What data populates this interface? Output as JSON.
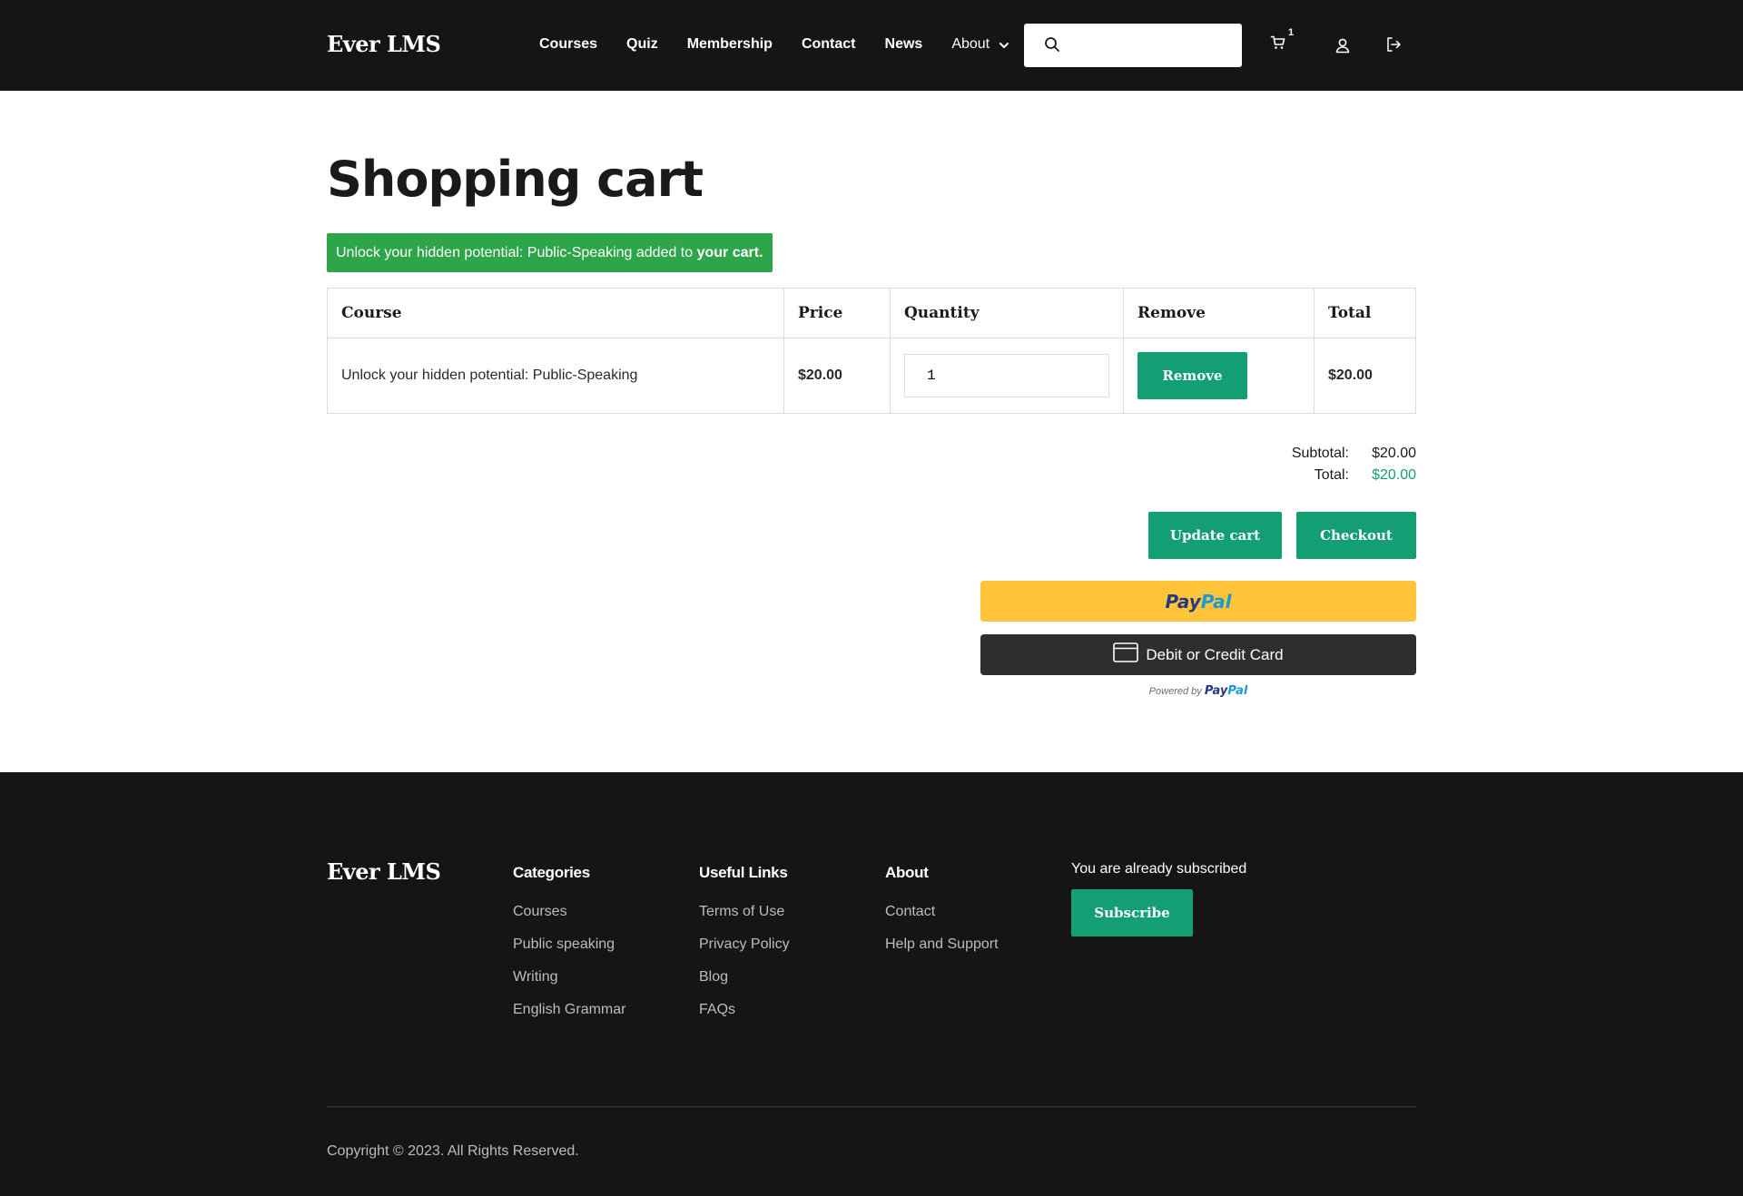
{
  "header": {
    "logo": "Ever LMS",
    "nav": {
      "courses": "Courses",
      "quiz": "Quiz",
      "membership": "Membership",
      "contact": "Contact",
      "news": "News",
      "about": "About"
    },
    "search": {
      "value": "",
      "placeholder": ""
    },
    "cart_count": "1"
  },
  "main": {
    "title": "Shopping cart",
    "alert": {
      "text": "Unlock your hidden potential: Public-Speaking added to ",
      "link": "your cart."
    },
    "table": {
      "headers": [
        "Course",
        "Price",
        "Quantity",
        "Remove",
        "Total"
      ],
      "rows": [
        {
          "course": "Unlock your hidden potential: Public-Speaking",
          "price": "$20.00",
          "quantity": "1",
          "remove_label": "Remove",
          "total": "$20.00"
        }
      ]
    },
    "totals": {
      "subtotal_label": "Subtotal:",
      "subtotal": "$20.00",
      "total_label": "Total:",
      "total": "$20.00"
    },
    "buttons": {
      "update": "Update cart",
      "checkout": "Checkout"
    },
    "paypal": {
      "pay": "Pay",
      "pal": "Pal",
      "card_label": "Debit or Credit Card",
      "powered_by": "Powered by"
    }
  },
  "footer": {
    "logo": "Ever LMS",
    "categories": {
      "title": "Categories",
      "links": [
        "Courses",
        "Public speaking",
        "Writing",
        "English Grammar"
      ]
    },
    "useful_links": {
      "title": "Useful Links",
      "links": [
        "Terms of Use",
        "Privacy Policy",
        "Blog",
        "FAQs"
      ]
    },
    "about": {
      "title": "About",
      "links": [
        "Contact",
        "Help and Support"
      ]
    },
    "subscribe": {
      "text": "You are already subscribed",
      "button": "Subscribe"
    },
    "copyright": "Copyright © 2023. All Rights Reserved."
  },
  "colors": {
    "header_bg": "#151515",
    "accent": "#149e74",
    "alert": "#2fa54a",
    "paypal_yellow": "#ffc439",
    "card_dark": "#2c2e2f"
  }
}
